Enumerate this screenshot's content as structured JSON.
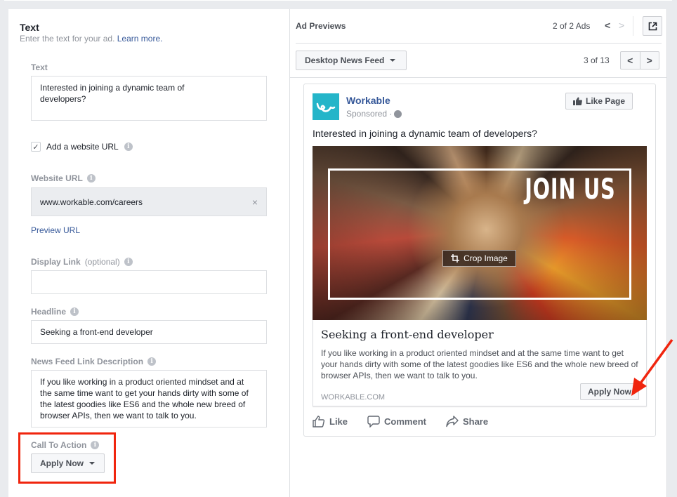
{
  "colors": {
    "accent_blue": "#365899",
    "highlight_red": "#f0250e",
    "brand_teal": "#24b5c9",
    "label_gray": "#90949c"
  },
  "left": {
    "section_title": "Text",
    "section_subtitle": "Enter the text for your ad.",
    "learn_more": "Learn more.",
    "text_label": "Text",
    "text_value": "Interested in joining a dynamic team of developers?",
    "add_url_label": "Add a website URL",
    "add_url_checked": true,
    "website_url_label": "Website URL",
    "website_url_value": "www.workable.com/careers",
    "preview_url": "Preview URL",
    "display_link_label": "Display Link",
    "display_link_optional": "(optional)",
    "display_link_value": "",
    "headline_label": "Headline",
    "headline_value": "Seeking a front-end developer",
    "description_label": "News Feed Link Description",
    "description_value": "If you like working in a product oriented mindset and at the same time want to get your hands dirty with some of the latest goodies like ES6 and the whole new breed of browser APIs, then we want to talk to you.",
    "cta_label": "Call To Action",
    "cta_value": "Apply Now"
  },
  "right": {
    "title": "Ad Previews",
    "ads_count": "2 of 2 Ads",
    "placement": "Desktop News Feed",
    "placement_count": "3 of 13",
    "ad": {
      "page_name": "Workable",
      "sponsored": "Sponsored ·",
      "like_page": "Like Page",
      "primary_text": "Interested in joining a dynamic team of developers?",
      "image_text": "JOIN US",
      "crop_image": "Crop Image",
      "headline": "Seeking a front-end developer",
      "description": "If you like working in a product oriented mindset and at the same time want to get your hands dirty with some of the latest goodies like ES6 and the whole new breed of browser APIs, then we want to talk to you.",
      "domain": "WORKABLE.COM",
      "cta": "Apply Now",
      "actions": [
        "Like",
        "Comment",
        "Share"
      ]
    }
  }
}
